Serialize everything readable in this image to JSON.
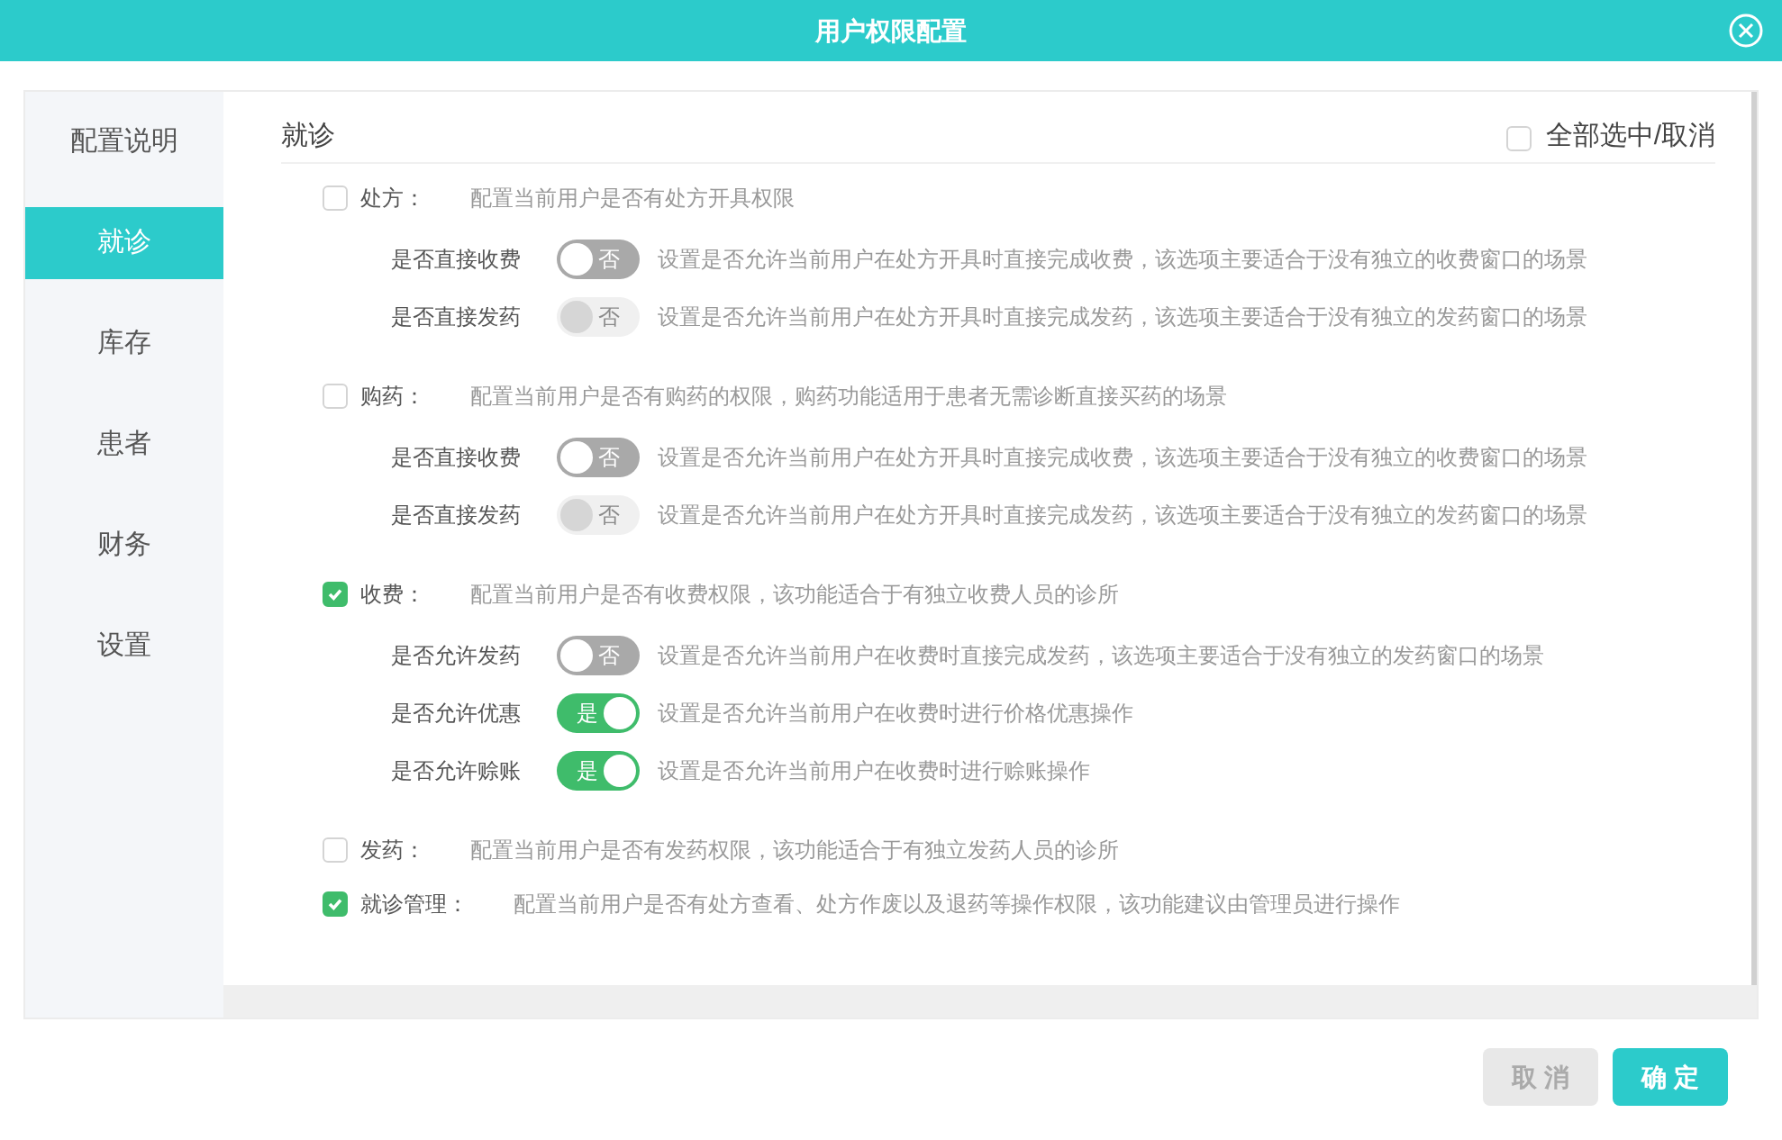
{
  "dialog": {
    "title": "用户权限配置"
  },
  "sidebar": {
    "items": [
      {
        "label": "配置说明",
        "selected": false
      },
      {
        "label": "就诊",
        "selected": true
      },
      {
        "label": "库存",
        "selected": false
      },
      {
        "label": "患者",
        "selected": false
      },
      {
        "label": "财务",
        "selected": false
      },
      {
        "label": "设置",
        "selected": false
      }
    ]
  },
  "panel": {
    "title": "就诊",
    "select_all": {
      "label": "全部选中/取消",
      "checked": false
    },
    "sections": [
      {
        "label": "处方：",
        "description": "配置当前用户是否有处方开具权限",
        "checked": false,
        "options": [
          {
            "label": "是否直接收费",
            "on": false,
            "disabled": false,
            "toggle_text": "否",
            "description": "设置是否允许当前用户在处方开具时直接完成收费，该选项主要适合于没有独立的收费窗口的场景"
          },
          {
            "label": "是否直接发药",
            "on": false,
            "disabled": true,
            "toggle_text": "否",
            "description": "设置是否允许当前用户在处方开具时直接完成发药，该选项主要适合于没有独立的发药窗口的场景"
          }
        ]
      },
      {
        "label": "购药：",
        "description": "配置当前用户是否有购药的权限，购药功能适用于患者无需诊断直接买药的场景",
        "checked": false,
        "options": [
          {
            "label": "是否直接收费",
            "on": false,
            "disabled": false,
            "toggle_text": "否",
            "description": "设置是否允许当前用户在处方开具时直接完成收费，该选项主要适合于没有独立的收费窗口的场景"
          },
          {
            "label": "是否直接发药",
            "on": false,
            "disabled": true,
            "toggle_text": "否",
            "description": "设置是否允许当前用户在处方开具时直接完成发药，该选项主要适合于没有独立的发药窗口的场景"
          }
        ]
      },
      {
        "label": "收费：",
        "description": "配置当前用户是否有收费权限，该功能适合于有独立收费人员的诊所",
        "checked": true,
        "options": [
          {
            "label": "是否允许发药",
            "on": false,
            "disabled": false,
            "toggle_text": "否",
            "description": "设置是否允许当前用户在收费时直接完成发药，该选项主要适合于没有独立的发药窗口的场景"
          },
          {
            "label": "是否允许优惠",
            "on": true,
            "disabled": false,
            "toggle_text": "是",
            "description": "设置是否允许当前用户在收费时进行价格优惠操作"
          },
          {
            "label": "是否允许赊账",
            "on": true,
            "disabled": false,
            "toggle_text": "是",
            "description": "设置是否允许当前用户在收费时进行赊账操作"
          }
        ]
      },
      {
        "label": "发药：",
        "description": "配置当前用户是否有发药权限，该功能适合于有独立发药人员的诊所",
        "checked": false
      },
      {
        "label": "就诊管理：",
        "description": "配置当前用户是否有处方查看、处方作废以及退药等操作权限，该功能建议由管理员进行操作",
        "checked": true
      }
    ]
  },
  "buttons": [
    {
      "label": "取 消",
      "kind": "secondary"
    },
    {
      "label": "确 定",
      "kind": "primary"
    }
  ]
}
